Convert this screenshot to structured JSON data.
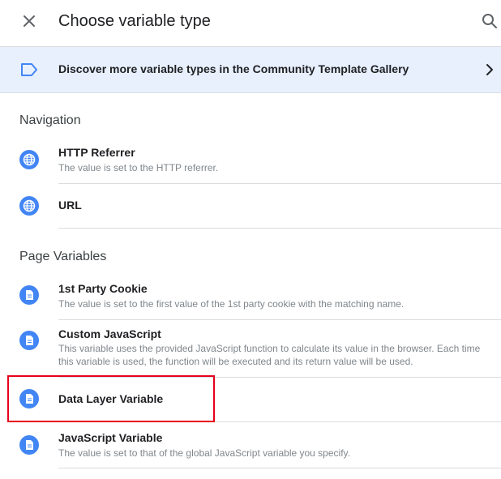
{
  "header": {
    "title": "Choose variable type",
    "close_icon": "close-icon",
    "search_icon": "search-icon"
  },
  "banner": {
    "icon": "label-icon",
    "text": "Discover more variable types in the Community Template Gallery",
    "chevron_icon": "chevron-right-icon"
  },
  "sections": [
    {
      "title": "Navigation",
      "items": [
        {
          "title": "HTTP Referrer",
          "description": "The value is set to the HTTP referrer.",
          "icon": "globe-icon"
        },
        {
          "title": "URL",
          "description": "",
          "icon": "globe-icon"
        }
      ]
    },
    {
      "title": "Page Variables",
      "items": [
        {
          "title": "1st Party Cookie",
          "description": "The value is set to the first value of the 1st party cookie with the matching name.",
          "icon": "document-icon"
        },
        {
          "title": "Custom JavaScript",
          "description": "This variable uses the provided JavaScript function to calculate its value in the browser. Each time this variable is used, the function will be executed and its return value will be used.",
          "icon": "document-icon"
        },
        {
          "title": "Data Layer Variable",
          "description": "",
          "icon": "document-icon",
          "highlighted": true
        },
        {
          "title": "JavaScript Variable",
          "description": "The value is set to that of the global JavaScript variable you specify.",
          "icon": "document-icon"
        }
      ]
    }
  ],
  "colors": {
    "icon_blue": "#4285f4",
    "banner_bg": "#e8f0fe",
    "highlight_red": "#e8001c",
    "divider": "#dadce0",
    "description_gray": "#80868b"
  }
}
